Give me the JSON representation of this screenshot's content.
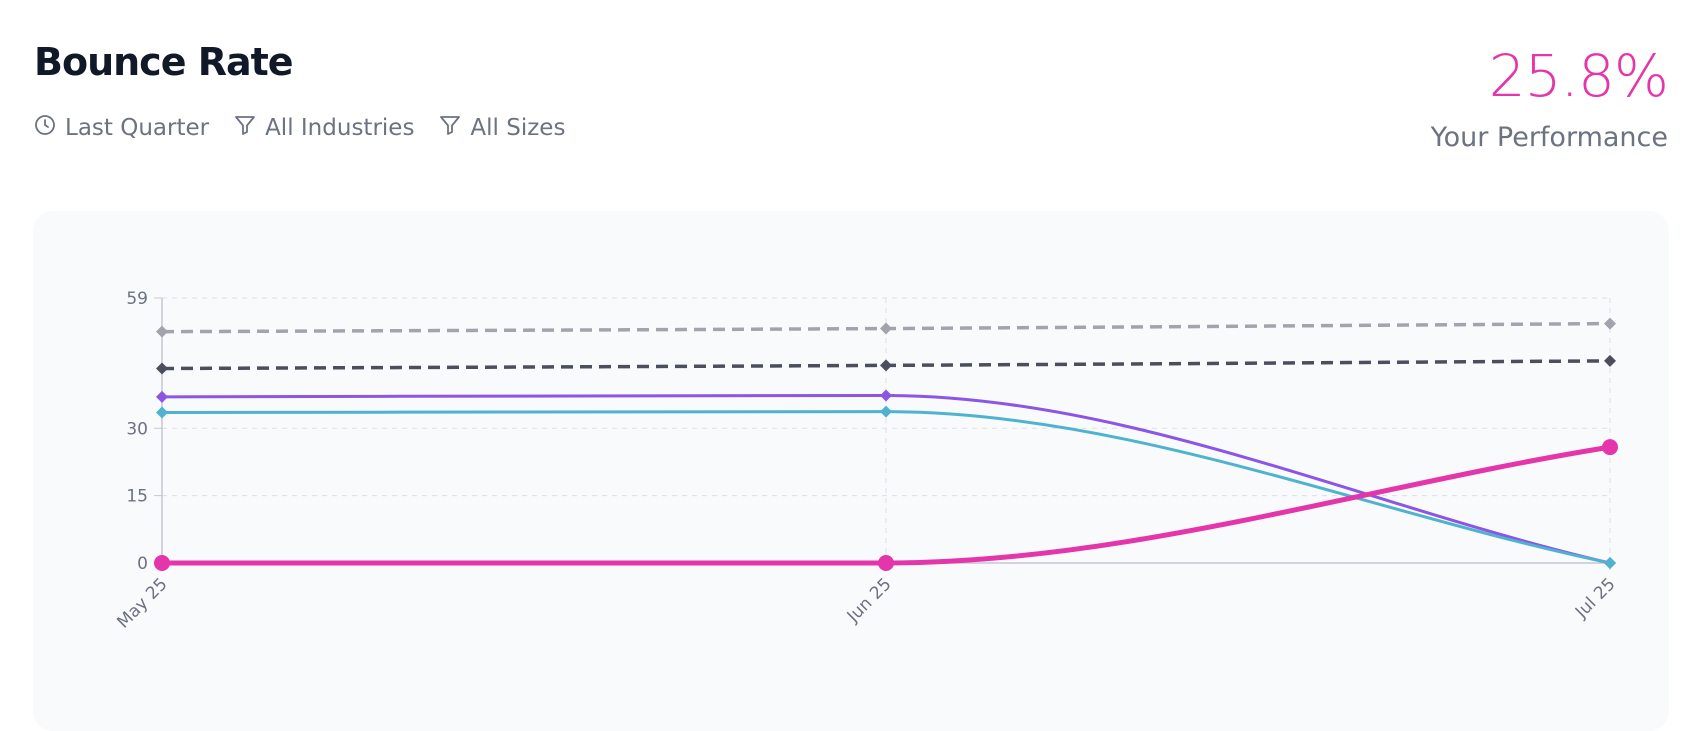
{
  "header": {
    "title": "Bounce Rate",
    "filters": [
      {
        "icon": "clock-icon",
        "label": "Last Quarter"
      },
      {
        "icon": "filter-icon",
        "label": "All Industries"
      },
      {
        "icon": "filter-icon",
        "label": "All Sizes"
      }
    ],
    "performance_value": "25.8%",
    "performance_label": "Your Performance"
  },
  "colors": {
    "accent": "#e535ab",
    "purple": "#8b55e6",
    "teal": "#4fb3cf",
    "dark": "#4b4f5c",
    "gray": "#a2a4ad"
  },
  "chart_data": {
    "type": "line",
    "categories": [
      "May 25",
      "Jun 25",
      "Jul 25"
    ],
    "ylim": [
      0,
      59
    ],
    "yticks": [
      0,
      15,
      30,
      59
    ],
    "grid": true,
    "series": [
      {
        "values": [
          51.5,
          52.2,
          53.3
        ],
        "color": "#a2a4ad",
        "dashed": true,
        "marker": "diamond"
      },
      {
        "values": [
          43.3,
          44.0,
          45.0
        ],
        "color": "#4b4f5c",
        "dashed": true,
        "marker": "diamond"
      },
      {
        "values": [
          37.0,
          37.3,
          0
        ],
        "color": "#8b55e6",
        "dashed": false,
        "marker": "diamond"
      },
      {
        "values": [
          33.5,
          33.7,
          0
        ],
        "color": "#4fb3cf",
        "dashed": false,
        "marker": "diamond"
      },
      {
        "values": [
          0,
          0,
          25.8
        ],
        "color": "#e535ab",
        "dashed": false,
        "marker": "circle"
      }
    ]
  }
}
